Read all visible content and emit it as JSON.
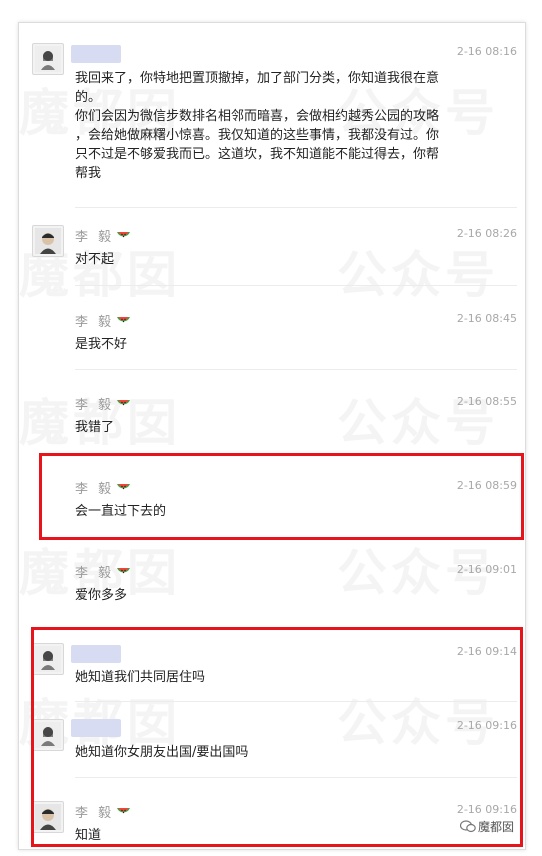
{
  "messages": [
    {
      "sender": "",
      "name_hidden": true,
      "avatar": "female-avatar",
      "time": "2-16 08:16",
      "lines": [
        "我回来了，你特地把置顶撤掉，加了部门分类，你知道我很在意",
        "的。",
        "你们会因为微信步数排名相邻而暗喜，会做相约越秀公园的攻略",
        "，会给她做麻糬小惊喜。我仅知道的这些事情，我都没有过。你",
        "只不过是不够爱我而已。这道坎，我不知道能不能过得去，你帮",
        "帮我"
      ]
    },
    {
      "sender": "李 毅",
      "name_hidden": false,
      "avatar": "male-avatar",
      "time": "2-16 08:26",
      "lines": [
        "对不起"
      ]
    },
    {
      "sender": "李 毅",
      "name_hidden": false,
      "avatar": "",
      "time": "2-16 08:45",
      "lines": [
        "是我不好"
      ]
    },
    {
      "sender": "李 毅",
      "name_hidden": false,
      "avatar": "",
      "time": "2-16 08:55",
      "lines": [
        "我错了"
      ]
    },
    {
      "sender": "李 毅",
      "name_hidden": false,
      "avatar": "",
      "time": "2-16 08:59",
      "lines": [
        "会一直过下去的"
      ]
    },
    {
      "sender": "李 毅",
      "name_hidden": false,
      "avatar": "",
      "time": "2-16 09:01",
      "lines": [
        "爱你多多"
      ]
    },
    {
      "sender": "",
      "name_hidden": true,
      "avatar": "female-avatar",
      "time": "2-16 09:14",
      "lines": [
        "她知道我们共同居住吗"
      ]
    },
    {
      "sender": "",
      "name_hidden": true,
      "avatar": "female-avatar",
      "time": "2-16 09:16",
      "lines": [
        "她知道你女朋友出国/要出国吗"
      ]
    },
    {
      "sender": "李 毅",
      "name_hidden": false,
      "avatar": "male-avatar",
      "time": "2-16 09:16",
      "lines": [
        "知道"
      ]
    }
  ],
  "watermark": {
    "left_text": "魔都囡",
    "right_text": "公众号"
  },
  "footer": {
    "brand": "魔都囡"
  },
  "colors": {
    "highlight": "#e8141b",
    "name_redaction": "#d8dcf3",
    "watermelon": "#3aa845"
  }
}
